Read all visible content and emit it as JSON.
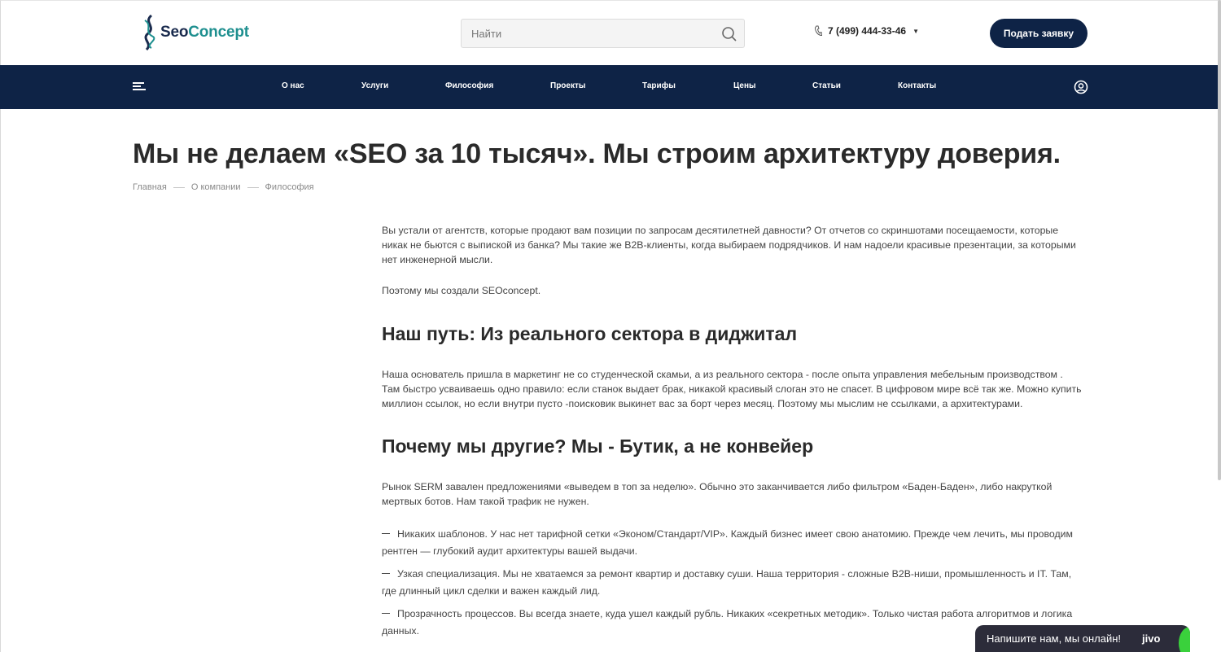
{
  "header": {
    "logo": {
      "text_main": "Seo",
      "text_accent": "Concept"
    },
    "search": {
      "placeholder": "Найти"
    },
    "phone": {
      "number": "7 (499) 444-33-46"
    },
    "cta_label": "Подать заявку"
  },
  "nav": {
    "items": [
      "О нас",
      "Услуги",
      "Философия",
      "Проекты",
      "Тарифы",
      "Цены",
      "Статьи",
      "Контакты"
    ]
  },
  "page": {
    "title": "Мы не делаем «SEO за 10 тысяч». Мы строим архитектуру доверия.",
    "breadcrumb": [
      "Главная",
      "О компании",
      "Философия"
    ]
  },
  "content": {
    "intro": "Вы устали от агентств, которые продают вам позиции по запросам десятилетней давности? От отчетов со скриншотами посещаемости, которые никак не бьются с выпиской из банка? Мы такие же B2B-клиенты, когда выбираем подрядчиков. И нам надоели красивые презентации, за которыми нет инженерной мысли.",
    "intro2": "Поэтому мы создали SEOconcept.",
    "h_path": "Наш путь: Из реального сектора в диджитал",
    "path_text": "Наша основатель пришла в маркетинг не со студенческой скамьи, а из реального сектора - после опыта управления мебельным производством . Там быстро усваиваешь одно правило: если станок выдает брак, никакой красивый слоган это не спасет. В цифровом мире всё так же. Можно купить миллион ссылок, но если внутри пусто -поисковик выкинет вас за борт через месяц. Поэтому мы мыслим не ссылками, а архитектурами.",
    "h_why": "Почему мы другие? Мы - Бутик, а не конвейер",
    "why_text": "Рынок SERM завален предложениями «выведем в топ за неделю». Обычно это заканчивается либо фильтром «Баден-Баден», либо накруткой мертвых ботов. Нам такой трафик не нужен.",
    "list": [
      "Никаких шаблонов. У нас нет тарифной сетки «Эконом/Стандарт/VIP». Каждый бизнес имеет свою анатомию. Прежде чем лечить, мы проводим рентген — глубокий аудит архитектуры вашей выдачи.",
      "Узкая специализация. Мы не хватаемся за ремонт квартир и доставку суши. Наша территория - сложные B2B-ниши, промышленность и IT. Там, где длинный цикл сделки и важен каждый лид.",
      "Прозрачность процессов. Вы всегда знаете, куда ушел каждый рубль. Никаких «секретных методик». Только чистая работа алгоритмов и логика данных."
    ]
  },
  "chat": {
    "label": "Напишите нам, мы онлайн!",
    "brand": "jivo"
  }
}
